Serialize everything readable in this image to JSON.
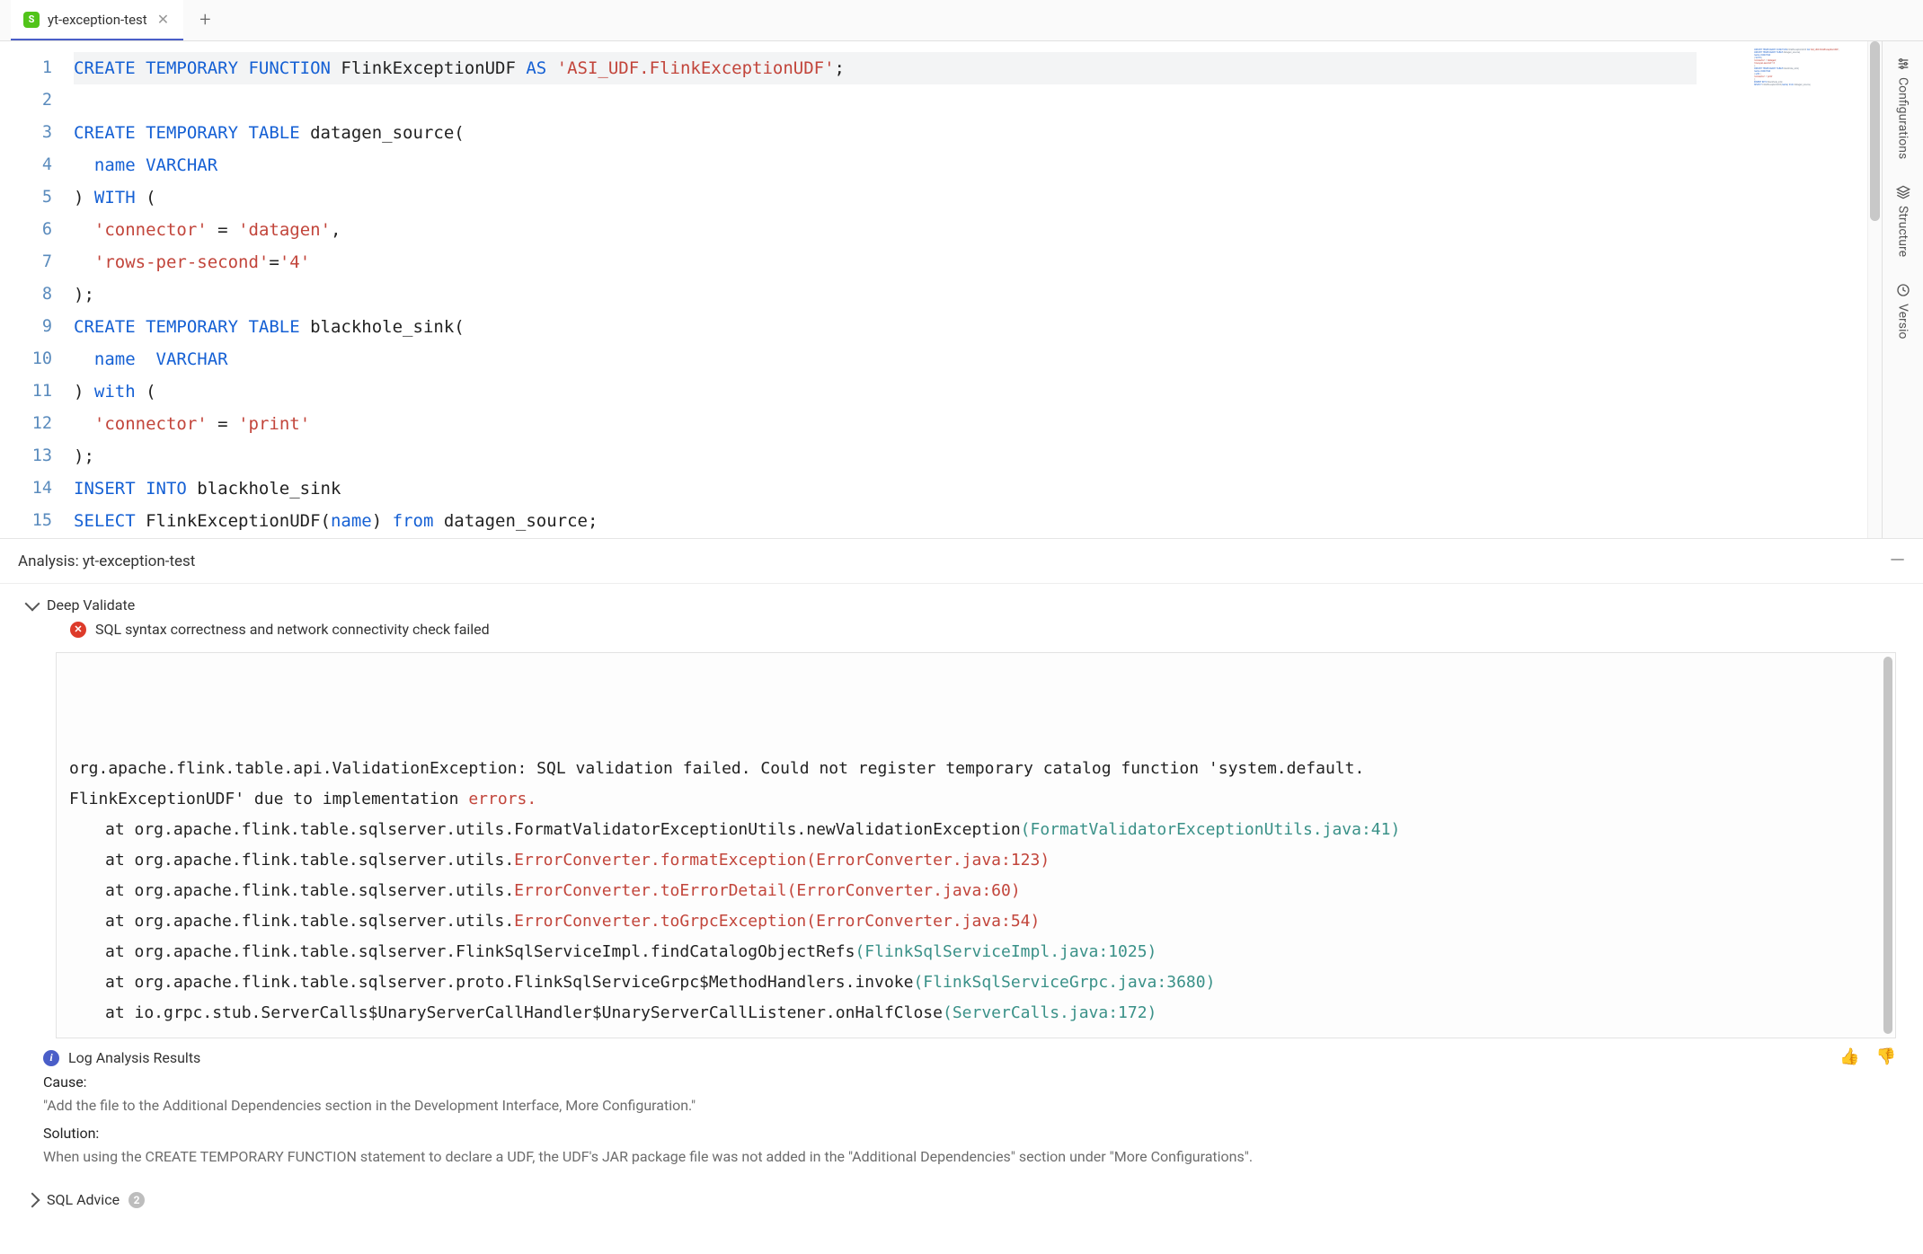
{
  "tabs": {
    "active": {
      "icon_letter": "S",
      "label": "yt-exception-test"
    }
  },
  "editor": {
    "lines": [
      [
        {
          "t": "CREATE TEMPORARY FUNCTION",
          "c": "tok-kw"
        },
        {
          "t": " FlinkExceptionUDF ",
          "c": "tok-id"
        },
        {
          "t": "AS",
          "c": "tok-kw"
        },
        {
          "t": " ",
          "c": "tok-id"
        },
        {
          "t": "'ASI_UDF.FlinkExceptionUDF'",
          "c": "tok-str"
        },
        {
          "t": ";",
          "c": "tok-pun"
        }
      ],
      [],
      [
        {
          "t": "CREATE TEMPORARY TABLE",
          "c": "tok-kw"
        },
        {
          "t": " datagen_source(",
          "c": "tok-id"
        }
      ],
      [
        {
          "t": "  name ",
          "c": "tok-col"
        },
        {
          "t": "VARCHAR",
          "c": "tok-type"
        }
      ],
      [
        {
          "t": ") ",
          "c": "tok-pun"
        },
        {
          "t": "WITH",
          "c": "tok-kw"
        },
        {
          "t": " (",
          "c": "tok-pun"
        }
      ],
      [
        {
          "t": "  ",
          "c": "tok-id"
        },
        {
          "t": "'connector'",
          "c": "tok-str"
        },
        {
          "t": " = ",
          "c": "tok-pun"
        },
        {
          "t": "'datagen'",
          "c": "tok-str"
        },
        {
          "t": ",",
          "c": "tok-pun"
        }
      ],
      [
        {
          "t": "  ",
          "c": "tok-id"
        },
        {
          "t": "'rows-per-second'",
          "c": "tok-str"
        },
        {
          "t": "=",
          "c": "tok-pun"
        },
        {
          "t": "'4'",
          "c": "tok-str"
        }
      ],
      [
        {
          "t": ");",
          "c": "tok-pun"
        }
      ],
      [
        {
          "t": "CREATE TEMPORARY TABLE",
          "c": "tok-kw"
        },
        {
          "t": " blackhole_sink(",
          "c": "tok-id"
        }
      ],
      [
        {
          "t": "  name  ",
          "c": "tok-col"
        },
        {
          "t": "VARCHAR",
          "c": "tok-type"
        }
      ],
      [
        {
          "t": ") ",
          "c": "tok-pun"
        },
        {
          "t": "with",
          "c": "tok-kw"
        },
        {
          "t": " (",
          "c": "tok-pun"
        }
      ],
      [
        {
          "t": "  ",
          "c": "tok-id"
        },
        {
          "t": "'connector'",
          "c": "tok-str"
        },
        {
          "t": " = ",
          "c": "tok-pun"
        },
        {
          "t": "'print'",
          "c": "tok-str"
        }
      ],
      [
        {
          "t": ");",
          "c": "tok-pun"
        }
      ],
      [
        {
          "t": "INSERT INTO",
          "c": "tok-kw"
        },
        {
          "t": " blackhole_sink",
          "c": "tok-id"
        }
      ],
      [
        {
          "t": "SELECT",
          "c": "tok-kw"
        },
        {
          "t": " FlinkExceptionUDF(",
          "c": "tok-id"
        },
        {
          "t": "name",
          "c": "tok-col"
        },
        {
          "t": ") ",
          "c": "tok-id"
        },
        {
          "t": "from",
          "c": "tok-kw"
        },
        {
          "t": " datagen_source;",
          "c": "tok-id"
        }
      ]
    ]
  },
  "rail": {
    "items": [
      {
        "icon": "sliders-icon",
        "label": "Configurations"
      },
      {
        "icon": "layers-icon",
        "label": "Structure"
      },
      {
        "icon": "history-icon",
        "label": "Versio"
      }
    ]
  },
  "analysis": {
    "header": "Analysis: yt-exception-test",
    "deep_validate_title": "Deep Validate",
    "error_summary": "SQL syntax correctness and network connectivity check failed",
    "stack": {
      "head1_a": "org.apache.flink.table.api.ValidationException: SQL validation failed. Could not register temporary catalog function 'system.default.",
      "head1_b": "FlinkExceptionUDF' due to implementation ",
      "head1_err": "errors.",
      "lines": [
        {
          "prefix": "at org.apache.flink.table.sqlserver.utils.FormatValidatorExceptionUtils.newValidationException",
          "link": "(FormatValidatorExceptionUtils.java:41)"
        },
        {
          "prefix": "at org.apache.flink.table.sqlserver.utils.",
          "red": "ErrorConverter.formatException(ErrorConverter.java:123)"
        },
        {
          "prefix": "at org.apache.flink.table.sqlserver.utils.",
          "red": "ErrorConverter.toErrorDetail(ErrorConverter.java:60)"
        },
        {
          "prefix": "at org.apache.flink.table.sqlserver.utils.",
          "red": "ErrorConverter.toGrpcException(ErrorConverter.java:54)"
        },
        {
          "prefix": "at org.apache.flink.table.sqlserver.FlinkSqlServiceImpl.findCatalogObjectRefs",
          "link": "(FlinkSqlServiceImpl.java:1025)"
        },
        {
          "prefix": "at org.apache.flink.table.sqlserver.proto.FlinkSqlServiceGrpc$MethodHandlers.invoke",
          "link": "(FlinkSqlServiceGrpc.java:3680)"
        },
        {
          "prefix": "at io.grpc.stub.ServerCalls$UnaryServerCallHandler$UnaryServerCallListener.onHalfClose",
          "link": "(ServerCalls.java:172)"
        }
      ]
    },
    "log_title": "Log Analysis Results",
    "cause_label": "Cause:",
    "cause_body": "\"Add the file to the Additional Dependencies section in the Development Interface, More Configuration.\"",
    "solution_label": "Solution:",
    "solution_body": "When using the CREATE TEMPORARY FUNCTION statement to declare a UDF, the UDF's JAR package file was not added in the \"Additional Dependencies\" section under \"More Configurations\".",
    "advice_title": "SQL Advice",
    "advice_count": "2"
  }
}
